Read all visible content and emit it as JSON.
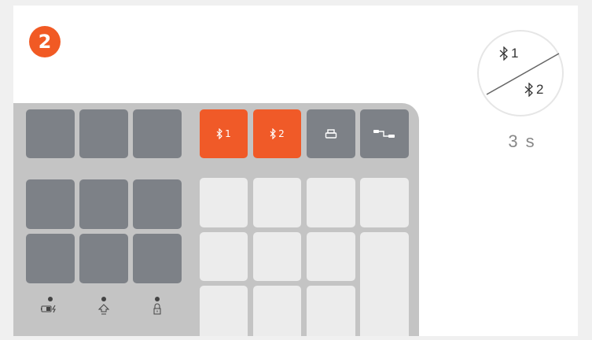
{
  "step": {
    "number": "2"
  },
  "keyboard": {
    "bt1_label": "1",
    "bt2_label": "2",
    "indicators": [
      "battery-charging-icon",
      "caps-lock-icon",
      "lock-icon"
    ]
  },
  "diagram": {
    "bt1_label": "1",
    "bt2_label": "2",
    "duration": "3 s"
  },
  "colors": {
    "accent": "#f05a28",
    "dark_key": "#7d8187",
    "light_key": "#ececec",
    "keyboard_body": "#c4c4c4"
  }
}
